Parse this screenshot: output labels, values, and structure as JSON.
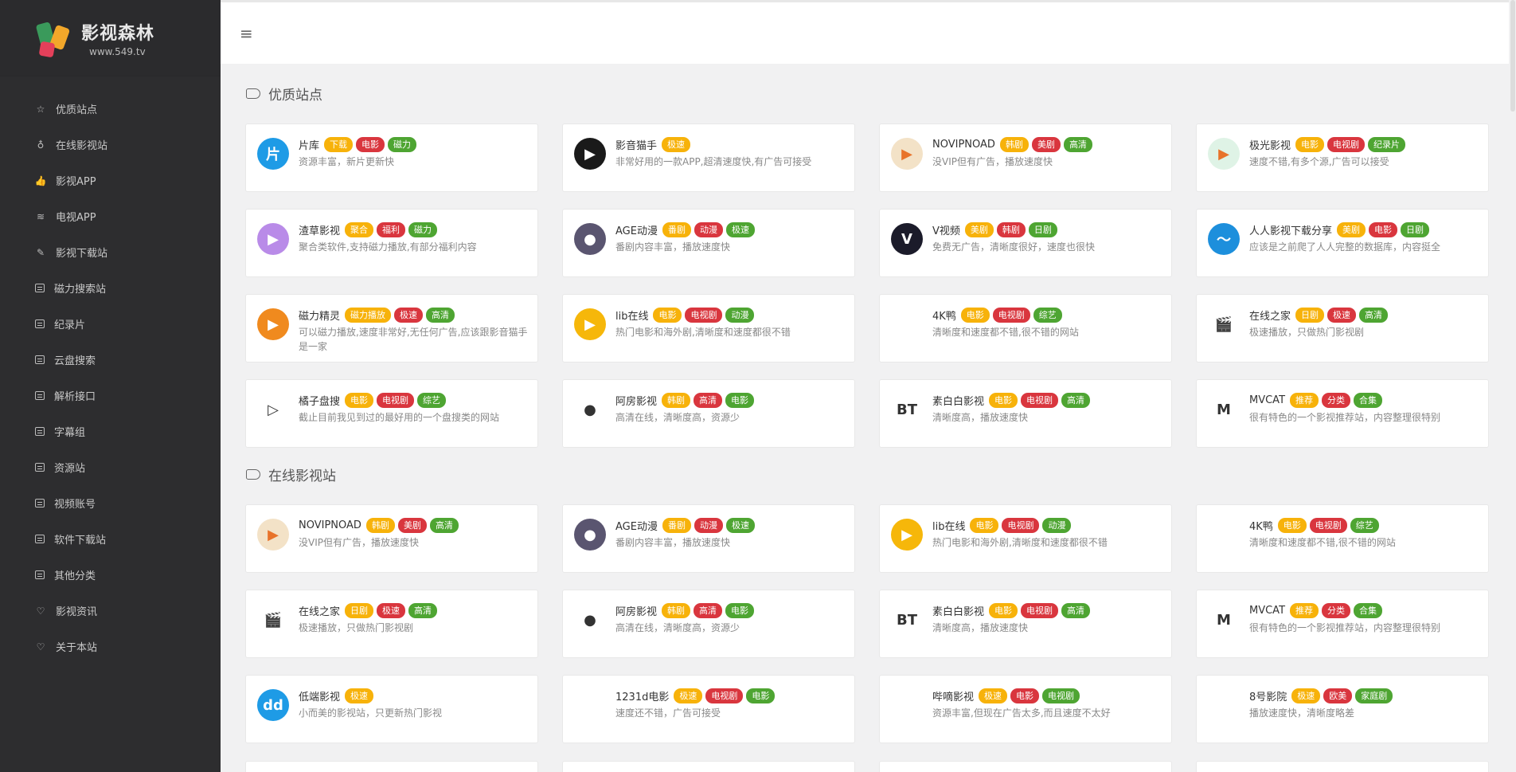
{
  "site": {
    "title": "影视森林",
    "url": "www.549.tv"
  },
  "sidebar": {
    "items": [
      {
        "label": "优质站点",
        "icon": "star-icon"
      },
      {
        "label": "在线影视站",
        "icon": "bulb-icon"
      },
      {
        "label": "影视APP",
        "icon": "thumbs-up-icon"
      },
      {
        "label": "电视APP",
        "icon": "wifi-icon"
      },
      {
        "label": "影视下载站",
        "icon": "pencil-icon"
      },
      {
        "label": "磁力搜索站",
        "icon": "list-icon"
      },
      {
        "label": "纪录片",
        "icon": "list-icon"
      },
      {
        "label": "云盘搜索",
        "icon": "list-icon"
      },
      {
        "label": "解析接口",
        "icon": "list-icon"
      },
      {
        "label": "字幕组",
        "icon": "list-icon"
      },
      {
        "label": "资源站",
        "icon": "list-icon"
      },
      {
        "label": "视频账号",
        "icon": "list-icon"
      },
      {
        "label": "软件下载站",
        "icon": "list-icon"
      },
      {
        "label": "其他分类",
        "icon": "list-icon"
      },
      {
        "label": "影视资讯",
        "icon": "heart-icon"
      },
      {
        "label": "关于本站",
        "icon": "heart-icon"
      }
    ]
  },
  "sections": [
    {
      "title": "优质站点",
      "cards": [
        {
          "name": "片库",
          "icon_text": "片",
          "icon_color": "#1e9be6",
          "tags": [
            [
              "下载",
              "orange"
            ],
            [
              "电影",
              "red"
            ],
            [
              "磁力",
              "green"
            ]
          ],
          "desc": "资源丰富，新片更新快"
        },
        {
          "name": "影音猫手",
          "icon_text": "▶",
          "icon_color": "#1a1a1a",
          "tags": [
            [
              "极速",
              "orange"
            ]
          ],
          "desc": "非常好用的一款APP,超清速度快,有广告可接受"
        },
        {
          "name": "NOVIPNOAD",
          "icon_text": "▶",
          "icon_color": "#f3e2c7",
          "tags": [
            [
              "韩剧",
              "orange"
            ],
            [
              "美剧",
              "red"
            ],
            [
              "高清",
              "green"
            ]
          ],
          "desc": "没VIP但有广告，播放速度快"
        },
        {
          "name": "极光影视",
          "icon_text": "▶",
          "icon_color": "#dff3e6",
          "tags": [
            [
              "电影",
              "orange"
            ],
            [
              "电视剧",
              "red"
            ],
            [
              "纪录片",
              "green"
            ]
          ],
          "desc": "速度不错,有多个源,广告可以接受"
        },
        {
          "name": "渣草影视",
          "icon_text": "▶",
          "icon_color": "#b98be8",
          "tags": [
            [
              "聚合",
              "orange"
            ],
            [
              "福利",
              "red"
            ],
            [
              "磁力",
              "green"
            ]
          ],
          "desc": "聚合类软件,支持磁力播放,有部分福利内容"
        },
        {
          "name": "AGE动漫",
          "icon_text": "●",
          "icon_color": "#5a5570",
          "tags": [
            [
              "番剧",
              "orange"
            ],
            [
              "动漫",
              "red"
            ],
            [
              "极速",
              "green"
            ]
          ],
          "desc": "番剧内容丰富，播放速度快"
        },
        {
          "name": "V视频",
          "icon_text": "V",
          "icon_color": "#1b1b2a",
          "tags": [
            [
              "美剧",
              "orange"
            ],
            [
              "韩剧",
              "red"
            ],
            [
              "日剧",
              "green"
            ]
          ],
          "desc": "免费无广告，清晰度很好，速度也很快"
        },
        {
          "name": "人人影视下载分享",
          "icon_text": "〜",
          "icon_color": "#1d8fdc",
          "tags": [
            [
              "美剧",
              "orange"
            ],
            [
              "电影",
              "red"
            ],
            [
              "日剧",
              "green"
            ]
          ],
          "desc": "应该是之前爬了人人完整的数据库，内容挺全"
        },
        {
          "name": "磁力精灵",
          "icon_text": "▶",
          "icon_color": "#f08a1e",
          "tags": [
            [
              "磁力播放",
              "orange"
            ],
            [
              "极速",
              "red"
            ],
            [
              "高清",
              "green"
            ]
          ],
          "desc": "可以磁力播放,速度非常好,无任何广告,应该跟影音猫手是一家"
        },
        {
          "name": "lib在线",
          "icon_text": "▶",
          "icon_color": "#f6b70a",
          "tags": [
            [
              "电影",
              "orange"
            ],
            [
              "电视剧",
              "red"
            ],
            [
              "动漫",
              "green"
            ]
          ],
          "desc": "热门电影和海外剧,清晰度和速度都很不错"
        },
        {
          "name": "4K鸭",
          "icon_text": "",
          "icon_color": "#ffffff",
          "tags": [
            [
              "电影",
              "orange"
            ],
            [
              "电视剧",
              "red"
            ],
            [
              "综艺",
              "green"
            ]
          ],
          "desc": "清晰度和速度都不错,很不错的网站"
        },
        {
          "name": "在线之家",
          "icon_text": "🎬",
          "icon_color": "#ffffff",
          "tags": [
            [
              "日剧",
              "orange"
            ],
            [
              "极速",
              "red"
            ],
            [
              "高清",
              "green"
            ]
          ],
          "desc": "极速播放，只做热门影视剧"
        },
        {
          "name": "橘子盘搜",
          "icon_text": "▷",
          "icon_color": "#ffffff",
          "tags": [
            [
              "电影",
              "orange"
            ],
            [
              "电视剧",
              "red"
            ],
            [
              "综艺",
              "green"
            ]
          ],
          "desc": "截止目前我见到过的最好用的一个盘搜类的网站"
        },
        {
          "name": "阿房影视",
          "icon_text": "●",
          "icon_color": "#ffffff",
          "tags": [
            [
              "韩剧",
              "orange"
            ],
            [
              "高清",
              "red"
            ],
            [
              "电影",
              "green"
            ]
          ],
          "desc": "高清在线，清晰度高，资源少"
        },
        {
          "name": "素白白影视",
          "icon_text": "BT",
          "icon_color": "#ffffff",
          "tags": [
            [
              "电影",
              "orange"
            ],
            [
              "电视剧",
              "red"
            ],
            [
              "高清",
              "green"
            ]
          ],
          "desc": "清晰度高，播放速度快"
        },
        {
          "name": "MVCAT",
          "icon_text": "M",
          "icon_color": "#ffffff",
          "tags": [
            [
              "推荐",
              "orange"
            ],
            [
              "分类",
              "red"
            ],
            [
              "合集",
              "green"
            ]
          ],
          "desc": "很有特色的一个影视推荐站，内容整理很特别"
        }
      ]
    },
    {
      "title": "在线影视站",
      "cards": [
        {
          "name": "NOVIPNOAD",
          "icon_text": "▶",
          "icon_color": "#f3e2c7",
          "tags": [
            [
              "韩剧",
              "orange"
            ],
            [
              "美剧",
              "red"
            ],
            [
              "高清",
              "green"
            ]
          ],
          "desc": "没VIP但有广告，播放速度快"
        },
        {
          "name": "AGE动漫",
          "icon_text": "●",
          "icon_color": "#5a5570",
          "tags": [
            [
              "番剧",
              "orange"
            ],
            [
              "动漫",
              "red"
            ],
            [
              "极速",
              "green"
            ]
          ],
          "desc": "番剧内容丰富，播放速度快"
        },
        {
          "name": "lib在线",
          "icon_text": "▶",
          "icon_color": "#f6b70a",
          "tags": [
            [
              "电影",
              "orange"
            ],
            [
              "电视剧",
              "red"
            ],
            [
              "动漫",
              "green"
            ]
          ],
          "desc": "热门电影和海外剧,清晰度和速度都很不错"
        },
        {
          "name": "4K鸭",
          "icon_text": "",
          "icon_color": "#ffffff",
          "tags": [
            [
              "电影",
              "orange"
            ],
            [
              "电视剧",
              "red"
            ],
            [
              "综艺",
              "green"
            ]
          ],
          "desc": "清晰度和速度都不错,很不错的网站"
        },
        {
          "name": "在线之家",
          "icon_text": "🎬",
          "icon_color": "#ffffff",
          "tags": [
            [
              "日剧",
              "orange"
            ],
            [
              "极速",
              "red"
            ],
            [
              "高清",
              "green"
            ]
          ],
          "desc": "极速播放，只做热门影视剧"
        },
        {
          "name": "阿房影视",
          "icon_text": "●",
          "icon_color": "#ffffff",
          "tags": [
            [
              "韩剧",
              "orange"
            ],
            [
              "高清",
              "red"
            ],
            [
              "电影",
              "green"
            ]
          ],
          "desc": "高清在线，清晰度高，资源少"
        },
        {
          "name": "素白白影视",
          "icon_text": "BT",
          "icon_color": "#ffffff",
          "tags": [
            [
              "电影",
              "orange"
            ],
            [
              "电视剧",
              "red"
            ],
            [
              "高清",
              "green"
            ]
          ],
          "desc": "清晰度高，播放速度快"
        },
        {
          "name": "MVCAT",
          "icon_text": "M",
          "icon_color": "#ffffff",
          "tags": [
            [
              "推荐",
              "orange"
            ],
            [
              "分类",
              "red"
            ],
            [
              "合集",
              "green"
            ]
          ],
          "desc": "很有特色的一个影视推荐站，内容整理很特别"
        },
        {
          "name": "低端影视",
          "icon_text": "dd",
          "icon_color": "#1e9be6",
          "tags": [
            [
              "极速",
              "orange"
            ]
          ],
          "desc": "小而美的影视站，只更新热门影视"
        },
        {
          "name": "1231d电影",
          "icon_text": "",
          "icon_color": "#ffffff",
          "tags": [
            [
              "极速",
              "orange"
            ],
            [
              "电视剧",
              "red"
            ],
            [
              "电影",
              "green"
            ]
          ],
          "desc": "速度还不错，广告可接受"
        },
        {
          "name": "哔嘀影视",
          "icon_text": "",
          "icon_color": "#ffffff",
          "tags": [
            [
              "极速",
              "orange"
            ],
            [
              "电影",
              "red"
            ],
            [
              "电视剧",
              "green"
            ]
          ],
          "desc": "资源丰富,但现在广告太多,而且速度不太好"
        },
        {
          "name": "8号影院",
          "icon_text": "",
          "icon_color": "#ffffff",
          "tags": [
            [
              "极速",
              "orange"
            ],
            [
              "欧美",
              "red"
            ],
            [
              "家庭剧",
              "green"
            ]
          ],
          "desc": "播放速度快，清晰度略差"
        }
      ]
    }
  ]
}
